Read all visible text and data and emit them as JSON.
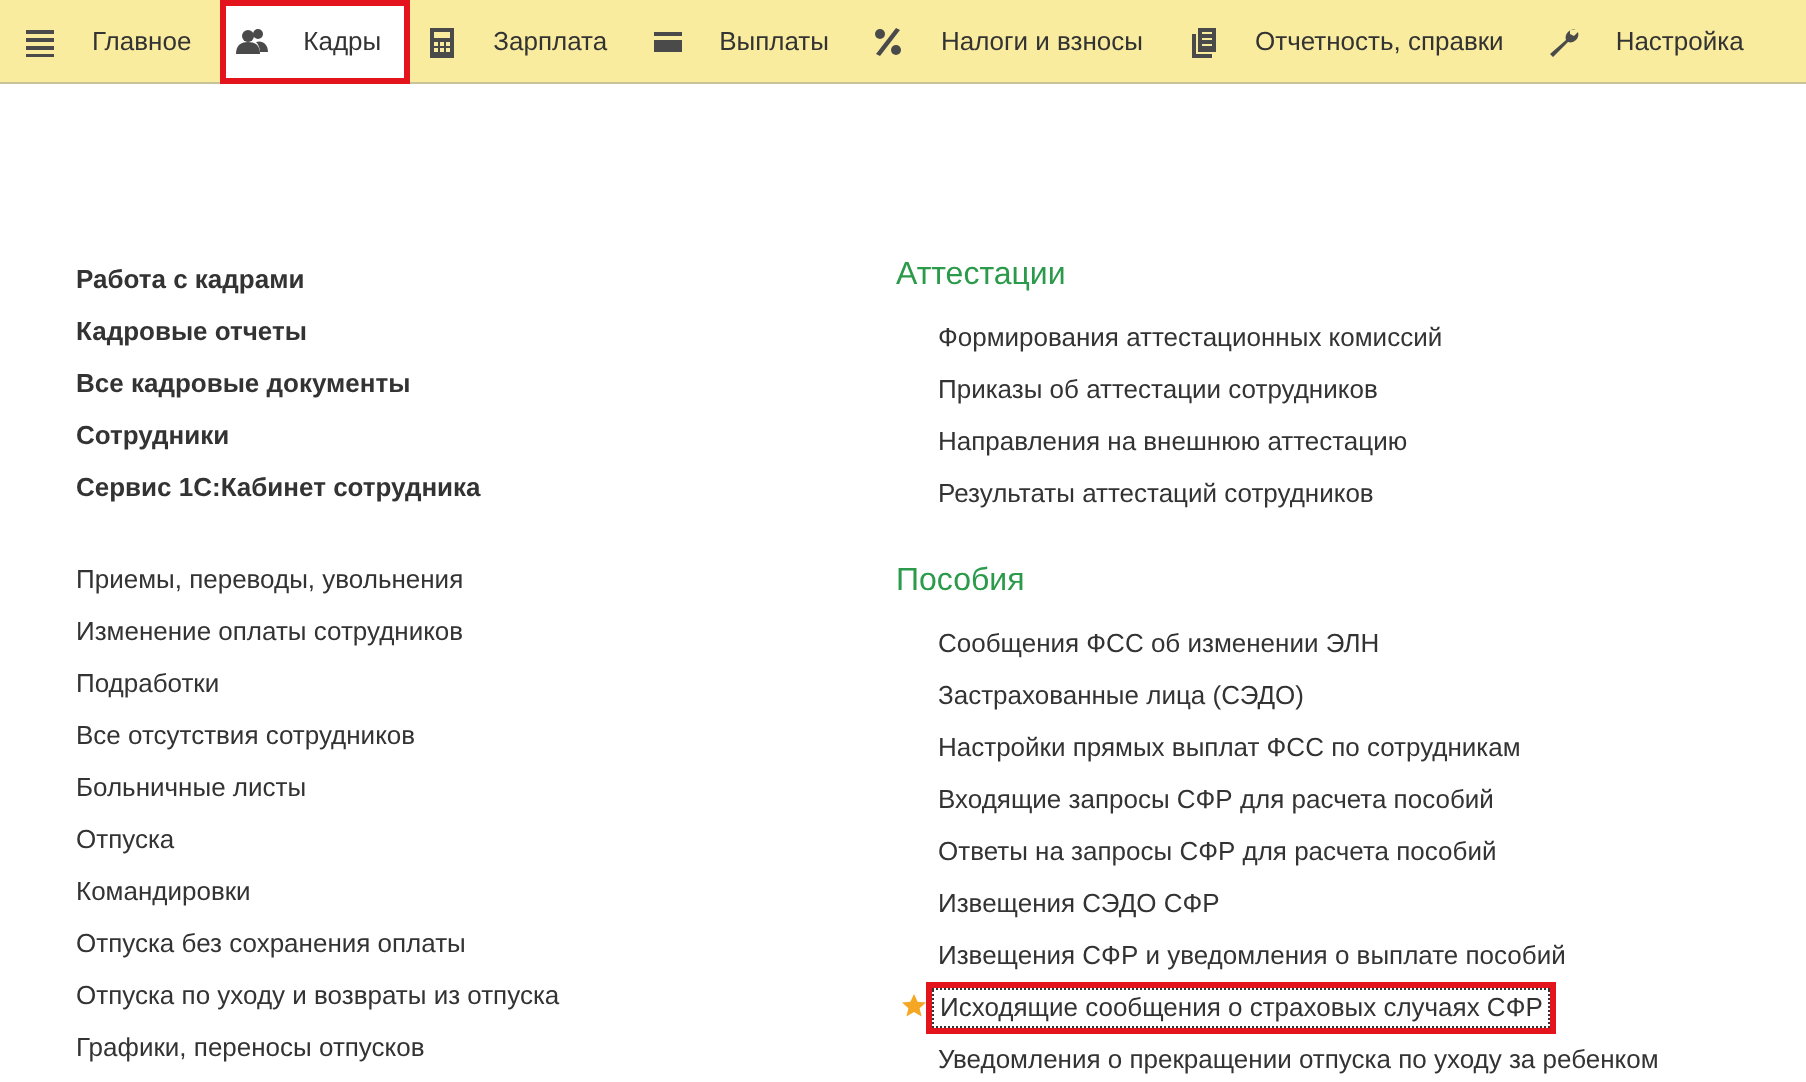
{
  "tabs": [
    {
      "label": "Главное",
      "kind": "menu",
      "selected": false,
      "highlighted": false
    },
    {
      "label": "Кадры",
      "kind": "people",
      "selected": true,
      "highlighted": true
    },
    {
      "label": "Зарплата",
      "kind": "calculator",
      "selected": false,
      "highlighted": false
    },
    {
      "label": "Выплаты",
      "kind": "card",
      "selected": false,
      "highlighted": false
    },
    {
      "label": "Налоги и взносы",
      "kind": "percent",
      "selected": false,
      "highlighted": false
    },
    {
      "label": "Отчетность, справки",
      "kind": "documents",
      "selected": false,
      "highlighted": false
    },
    {
      "label": "Настройка",
      "kind": "wrench",
      "selected": false,
      "highlighted": false
    }
  ],
  "left_column": {
    "main_links": [
      "Работа с кадрами",
      "Кадровые отчеты",
      "Все кадровые документы",
      "Сотрудники",
      "Сервис 1С:Кабинет сотрудника"
    ],
    "links": [
      "Приемы, переводы, увольнения",
      "Изменение оплаты сотрудников",
      "Подработки",
      "Все отсутствия сотрудников",
      "Больничные листы",
      "Отпуска",
      "Командировки",
      "Отпуска без сохранения оплаты",
      "Отпуска по уходу и возвраты из отпуска",
      "Графики, переносы отпусков"
    ]
  },
  "right_column": [
    {
      "heading": "Аттестации",
      "items": [
        {
          "label": "Формирования аттестационных комиссий",
          "favorite": false,
          "highlighted": false
        },
        {
          "label": "Приказы об аттестации сотрудников",
          "favorite": false,
          "highlighted": false
        },
        {
          "label": "Направления на внешнюю аттестацию",
          "favorite": false,
          "highlighted": false
        },
        {
          "label": "Результаты аттестаций сотрудников",
          "favorite": false,
          "highlighted": false
        }
      ]
    },
    {
      "heading": "Пособия",
      "items": [
        {
          "label": "Сообщения ФСС об изменении ЭЛН",
          "favorite": false,
          "highlighted": false
        },
        {
          "label": "Застрахованные лица (СЭДО)",
          "favorite": false,
          "highlighted": false
        },
        {
          "label": "Настройки прямых выплат ФСС по сотрудникам",
          "favorite": false,
          "highlighted": false
        },
        {
          "label": "Входящие запросы СФР для расчета пособий",
          "favorite": false,
          "highlighted": false
        },
        {
          "label": "Ответы на запросы СФР для расчета пособий",
          "favorite": false,
          "highlighted": false
        },
        {
          "label": "Извещения СЭДО СФР",
          "favorite": false,
          "highlighted": false
        },
        {
          "label": "Извещения СФР и уведомления о выплате пособий",
          "favorite": false,
          "highlighted": false
        },
        {
          "label": "Исходящие сообщения о страховых случаях СФР",
          "favorite": true,
          "highlighted": true
        },
        {
          "label": "Уведомления о прекращении отпуска по уходу за ребенком",
          "favorite": false,
          "highlighted": false
        }
      ]
    }
  ]
}
